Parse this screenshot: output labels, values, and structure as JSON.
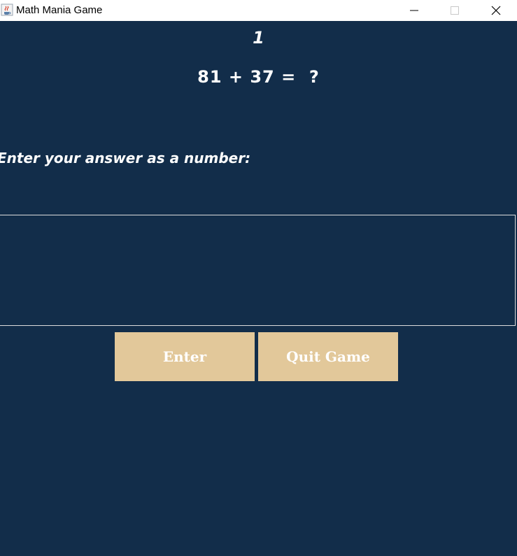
{
  "window": {
    "title": "Math Mania Game"
  },
  "game": {
    "round": "1",
    "question": "81 + 37 =  ?",
    "prompt": "Enter your answer as a number:",
    "answer_value": ""
  },
  "buttons": {
    "enter_label": "Enter",
    "quit_label": "Quit Game"
  },
  "icons": {
    "app": "java-coffee-cup-icon",
    "minimize": "minimize-icon",
    "maximize": "maximize-icon",
    "close": "close-icon"
  },
  "colors": {
    "background": "#122d4a",
    "button": "#e2c89a",
    "text": "#ffffff",
    "titlebar": "#ffffff"
  }
}
